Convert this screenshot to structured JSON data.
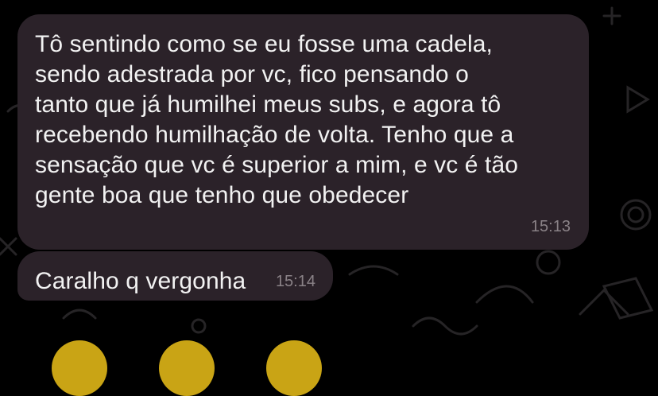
{
  "messages": [
    {
      "text": "Tô sentindo como se eu fosse uma cadela,\nsendo adestrada por vc, fico pensando o\ntanto que já humilhei meus subs, e agora tô\nrecebendo humilhação de volta. Tenho que a\nsensação que vc é superior a mim, e vc é tão\ngente boa que tenho que obedecer",
      "time": "15:13"
    },
    {
      "text": "Caralho q vergonha",
      "time": "15:14"
    }
  ],
  "colors": {
    "background": "#000000",
    "bubble": "#2b2229",
    "text": "#f2f2f2",
    "timestamp": "#8a8287"
  }
}
